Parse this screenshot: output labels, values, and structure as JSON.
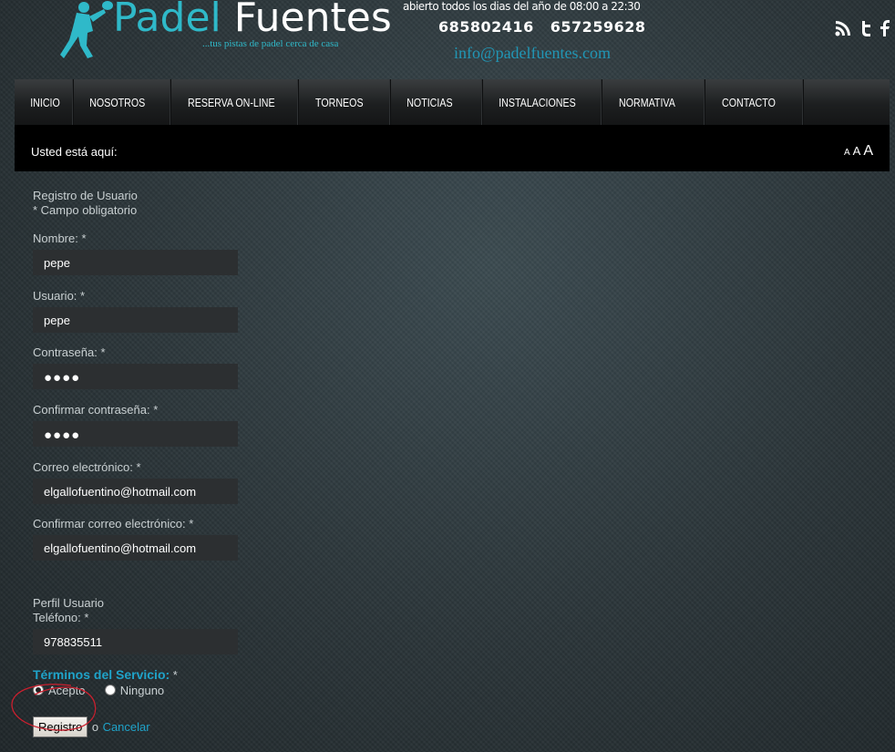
{
  "header": {
    "brand_word1": "Padel",
    "brand_word2": "Fuentes",
    "tagline": "...tus pistas de padel cerca de casa",
    "hours": "abierto todos los dias del año de 08:00 a 22:30",
    "phone1": "685802416",
    "phone2": "657259628",
    "email": "info@padelfuentes.com",
    "social_icons": [
      "rss-icon",
      "twitter-icon",
      "facebook-icon"
    ]
  },
  "nav": {
    "items": [
      "INICIO",
      "NOSOTROS",
      "RESERVA ON-LINE",
      "TORNEOS",
      "NOTICIAS",
      "INSTALACIONES",
      "NORMATIVA",
      "CONTACTO"
    ]
  },
  "breadcrumb": {
    "label": "Usted está aquí:",
    "font_sizes": [
      "A",
      "A",
      "A"
    ]
  },
  "form": {
    "title": "Registro de Usuario",
    "required_note": "* Campo obligatorio",
    "nombre_label": "Nombre:",
    "nombre_value": "pepe",
    "usuario_label": "Usuario:",
    "usuario_value": "pepe",
    "password_label": "Contraseña:",
    "password_mask": "●●●●",
    "confirm_password_label": "Confirmar contraseña:",
    "confirm_password_mask": "●●●●",
    "email_label": "Correo electrónico:",
    "email_value": "elgallofuentino@hotmail.com",
    "confirm_email_label": "Confirmar correo electrónico:",
    "confirm_email_value": "elgallofuentino@hotmail.com",
    "profile_section": "Perfil Usuario",
    "phone_label": "Teléfono:",
    "phone_value": "978835511",
    "terms_label": "Términos del Servicio:",
    "accept_label": "Acepto",
    "decline_label": "Ninguno",
    "submit_label": "Registro",
    "or_text": "o",
    "cancel_label": "Cancelar",
    "required_mark": "*"
  },
  "colors": {
    "accent": "#1fa3c9",
    "brand": "#2fb9c9",
    "annotation": "#cc1f2e"
  }
}
